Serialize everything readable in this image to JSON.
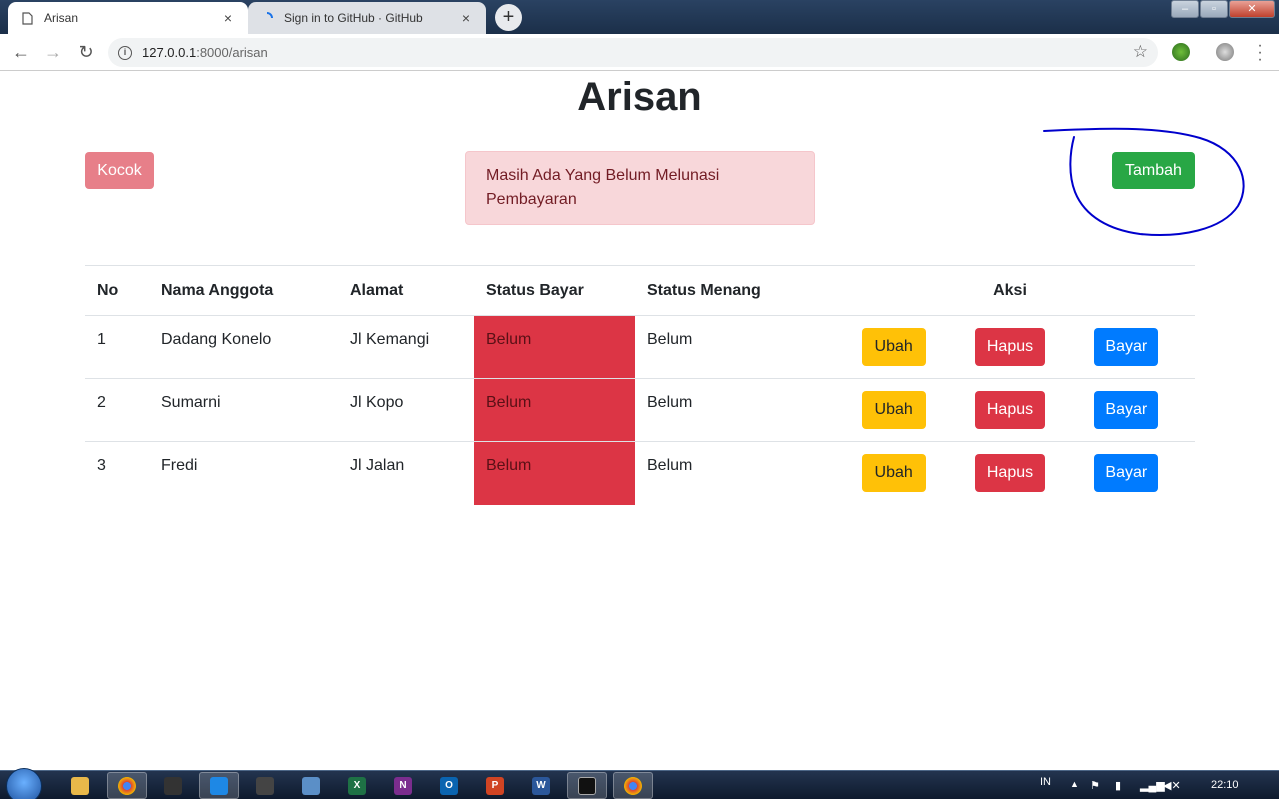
{
  "browser": {
    "tabs": [
      {
        "title": "Arisan",
        "close": "×"
      },
      {
        "title": "Sign in to GitHub · GitHub",
        "close": "×"
      }
    ],
    "new_tab": "+",
    "url_host": "127.0.0.1",
    "url_path": ":8000/arisan"
  },
  "page": {
    "title": "Arisan",
    "kocok_label": "Kocok",
    "tambah_label": "Tambah",
    "alert_text": "Masih Ada Yang Belum Melunasi Pembayaran"
  },
  "table": {
    "headers": [
      "No",
      "Nama Anggota",
      "Alamat",
      "Status Bayar",
      "Status Menang",
      "Aksi"
    ],
    "rows": [
      {
        "no": "1",
        "nama": "Dadang Konelo",
        "alamat": "Jl Kemangi",
        "status_bayar": "Belum",
        "status_menang": "Belum"
      },
      {
        "no": "2",
        "nama": "Sumarni",
        "alamat": "Jl Kopo",
        "status_bayar": "Belum",
        "status_menang": "Belum"
      },
      {
        "no": "3",
        "nama": "Fredi",
        "alamat": "Jl Jalan",
        "status_bayar": "Belum",
        "status_menang": "Belum"
      }
    ],
    "actions": {
      "ubah": "Ubah",
      "hapus": "Hapus",
      "bayar": "Bayar"
    }
  },
  "taskbar": {
    "lang": "IN",
    "clock": "22:10"
  },
  "colors": {
    "danger": "#dc3545",
    "success": "#28a745",
    "warning": "#ffc107",
    "primary": "#007bff",
    "annotation": "#0000cc"
  }
}
